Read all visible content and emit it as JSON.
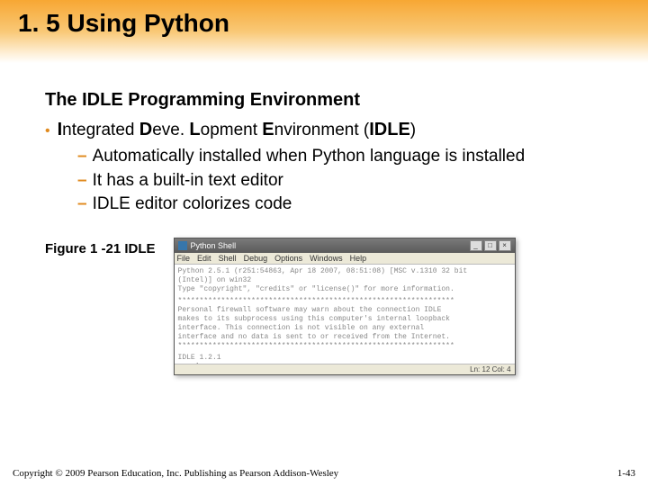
{
  "header": {
    "title": "1. 5 Using Python"
  },
  "subhead": "The IDLE Programming Environment",
  "acronym": {
    "p1": "I",
    "p2": "ntegrated ",
    "p3": "D",
    "p4": "eve. ",
    "p5": "L",
    "p6": "opment ",
    "p7": "E",
    "p8": "nvironment (",
    "p9": "IDLE",
    "p10": ")"
  },
  "subitems": [
    "Automatically installed when Python language is installed",
    "It has a built-in text editor",
    "IDLE editor colorizes code"
  ],
  "figure": {
    "label": "Figure 1 -21  IDLE",
    "window_title": "Python Shell",
    "menus": [
      "File",
      "Edit",
      "Shell",
      "Debug",
      "Options",
      "Windows",
      "Help"
    ],
    "lines": {
      "l1": "Python 2.5.1 (r251:54863, Apr 18 2007, 08:51:08) [MSC v.1310 32 bit",
      "l2": "(Intel)] on win32",
      "l3": "Type \"copyright\", \"credits\" or \"license()\" for more information.",
      "sep": "****************************************************************",
      "l4": "Personal firewall software may warn about the connection IDLE",
      "l5": "makes to its subprocess using this computer's internal loopback",
      "l6": "interface.  This connection is not visible on any external",
      "l7": "interface and no data is sent to or received from the Internet.",
      "l8": "IDLE 1.2.1",
      "prompt": ">>> |"
    },
    "status": "Ln: 12 Col: 4"
  },
  "footer": {
    "copyright": "Copyright © 2009 Pearson Education, Inc. Publishing as Pearson Addison-Wesley",
    "page": "1-43"
  }
}
